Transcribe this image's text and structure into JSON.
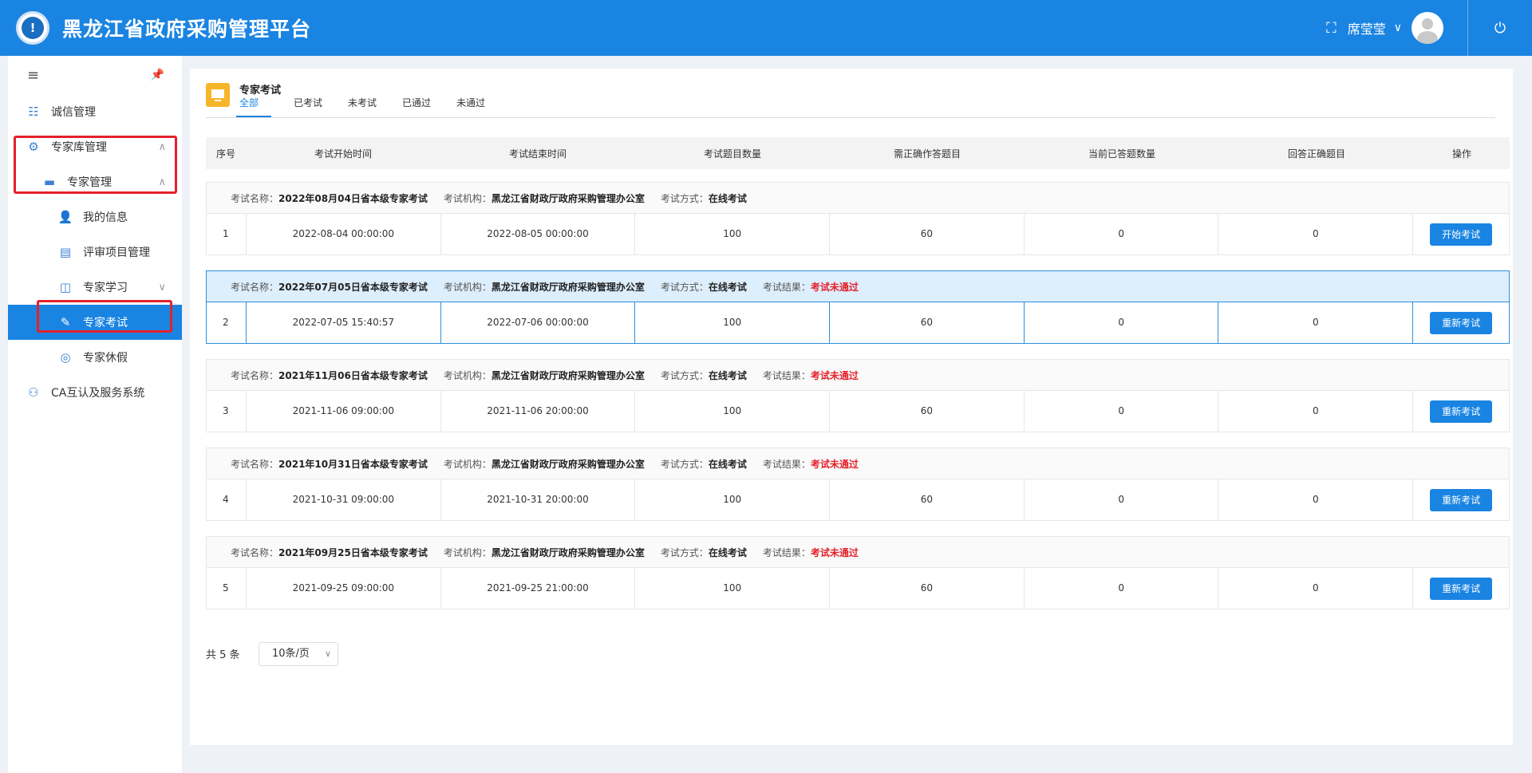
{
  "header": {
    "logo_glyph": "!",
    "title": "黑龙江省政府采购管理平台",
    "fullscreen_icon": "⛶",
    "username": "席莹莹",
    "chevron": "∨",
    "power_icon": "⏻"
  },
  "sidebar": {
    "menu_icon": "≡",
    "pin_icon": "📌",
    "items": [
      {
        "label": "诚信管理",
        "icon": "☷"
      },
      {
        "label": "专家库管理",
        "icon": "⚙"
      },
      {
        "label": "专家管理",
        "icon": "▬"
      },
      {
        "label": "我的信息",
        "icon": "👤"
      },
      {
        "label": "评审项目管理",
        "icon": "▤"
      },
      {
        "label": "专家学习",
        "icon": "◫"
      },
      {
        "label": "专家考试",
        "icon": "✎"
      },
      {
        "label": "专家休假",
        "icon": "◎"
      },
      {
        "label": "CA互认及服务系统",
        "icon": "⚇"
      }
    ],
    "arrow_up": "∧",
    "arrow_down": "∨"
  },
  "page": {
    "section_title": "专家考试",
    "tabs": [
      "全部",
      "已考试",
      "未考试",
      "已通过",
      "未通过"
    ]
  },
  "table": {
    "headers": [
      "序号",
      "考试开始时间",
      "考试结束时间",
      "考试题目数量",
      "需正确作答题目",
      "当前已答题数量",
      "回答正确题目",
      "操作"
    ],
    "labels": {
      "name": "考试名称：",
      "org": "考试机构：",
      "mode": "考试方式：",
      "result": "考试结果："
    },
    "rows": [
      {
        "name": "2022年08月04日省本级专家考试",
        "org": "黑龙江省财政厅政府采购管理办公室",
        "mode": "在线考试",
        "result": "",
        "index": "1",
        "start": "2022-08-04 00:00:00",
        "end": "2022-08-05 00:00:00",
        "total": "100",
        "required": "60",
        "answered": "0",
        "correct": "0",
        "action": "开始考试"
      },
      {
        "name": "2022年07月05日省本级专家考试",
        "org": "黑龙江省财政厅政府采购管理办公室",
        "mode": "在线考试",
        "result": "考试未通过",
        "index": "2",
        "start": "2022-07-05 15:40:57",
        "end": "2022-07-06 00:00:00",
        "total": "100",
        "required": "60",
        "answered": "0",
        "correct": "0",
        "action": "重新考试"
      },
      {
        "name": "2021年11月06日省本级专家考试",
        "org": "黑龙江省财政厅政府采购管理办公室",
        "mode": "在线考试",
        "result": "考试未通过",
        "index": "3",
        "start": "2021-11-06 09:00:00",
        "end": "2021-11-06 20:00:00",
        "total": "100",
        "required": "60",
        "answered": "0",
        "correct": "0",
        "action": "重新考试"
      },
      {
        "name": "2021年10月31日省本级专家考试",
        "org": "黑龙江省财政厅政府采购管理办公室",
        "mode": "在线考试",
        "result": "考试未通过",
        "index": "4",
        "start": "2021-10-31 09:00:00",
        "end": "2021-10-31 20:00:00",
        "total": "100",
        "required": "60",
        "answered": "0",
        "correct": "0",
        "action": "重新考试"
      },
      {
        "name": "2021年09月25日省本级专家考试",
        "org": "黑龙江省财政厅政府采购管理办公室",
        "mode": "在线考试",
        "result": "考试未通过",
        "index": "5",
        "start": "2021-09-25 09:00:00",
        "end": "2021-09-25 21:00:00",
        "total": "100",
        "required": "60",
        "answered": "0",
        "correct": "0",
        "action": "重新考试"
      }
    ]
  },
  "pagination": {
    "total_text": "共 5 条",
    "page_size": "10条/页",
    "chevron": "∨"
  }
}
